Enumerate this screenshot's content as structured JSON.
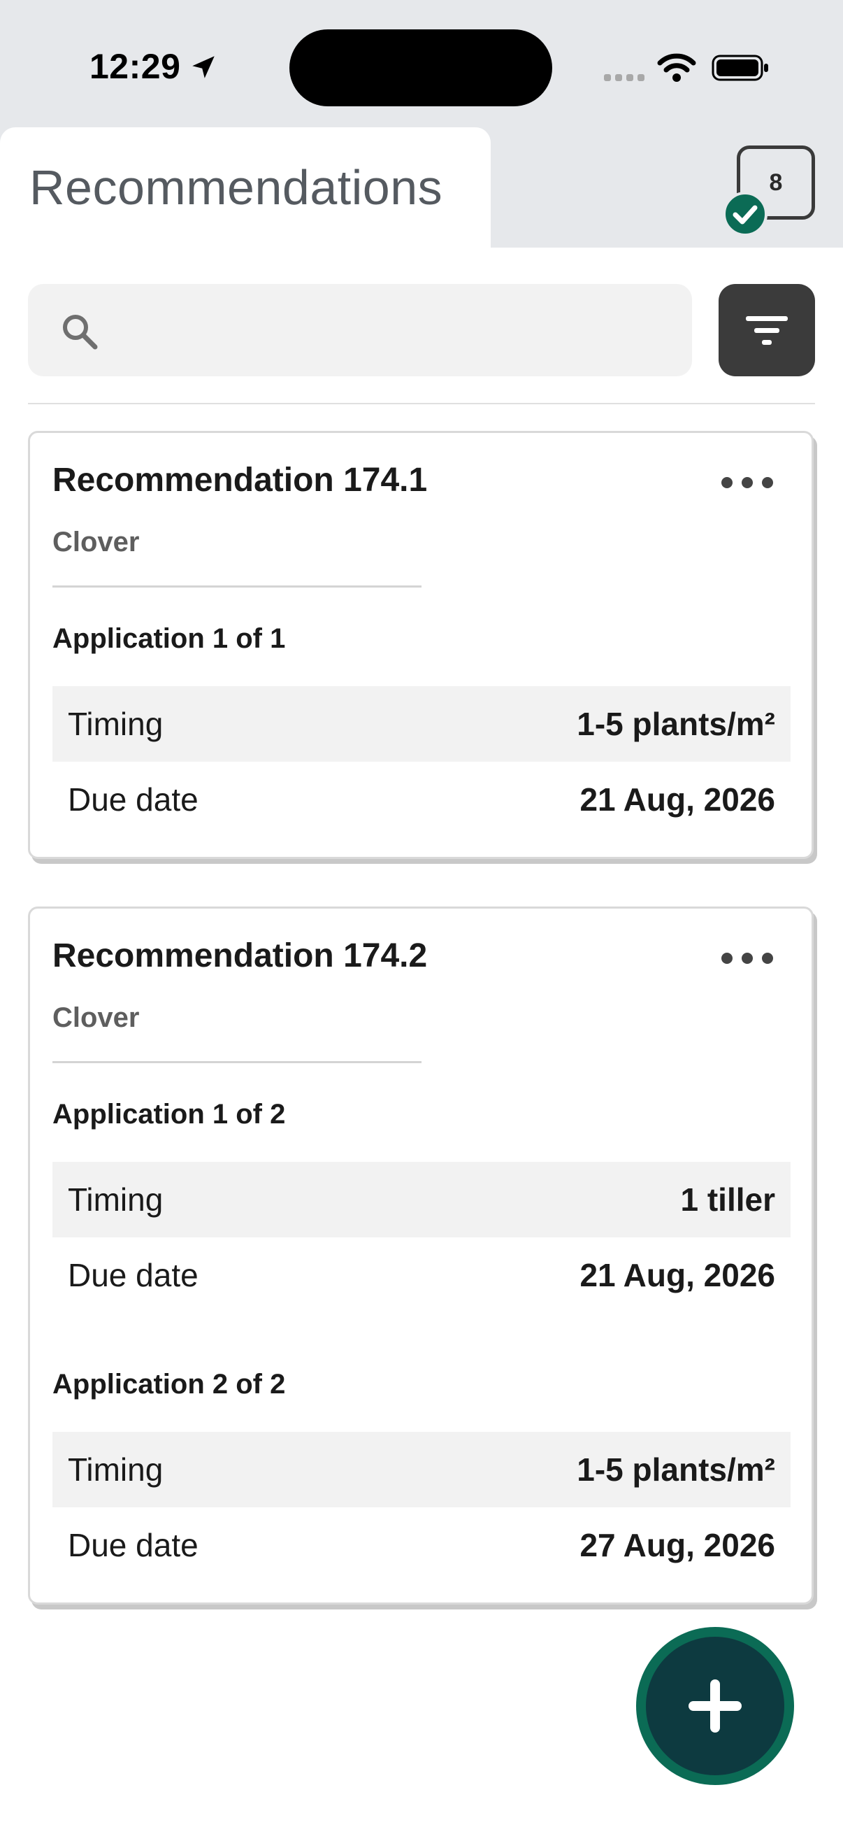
{
  "status_bar": {
    "time": "12:29"
  },
  "header": {
    "title": "Recommendations",
    "badge_count": "8"
  },
  "search": {
    "placeholder": ""
  },
  "colors": {
    "accent_green": "#0b6b55",
    "fab_dark": "#0d3a40",
    "filter_button": "#3b3b3b"
  },
  "icons": {
    "location": "location-arrow-icon",
    "wifi": "wifi-icon",
    "battery": "battery-icon",
    "search": "search-icon",
    "filter": "filter-icon",
    "more": "more-horizontal-icon",
    "check": "check-icon",
    "add": "plus-icon"
  },
  "cards": [
    {
      "title": "Recommendation 174.1",
      "crop": "Clover",
      "applications": [
        {
          "heading": "Application 1 of 1",
          "timing_label": "Timing",
          "timing_value": "1-5 plants/m²",
          "due_label": "Due date",
          "due_value": "21 Aug, 2026"
        }
      ]
    },
    {
      "title": "Recommendation 174.2",
      "crop": "Clover",
      "applications": [
        {
          "heading": "Application 1 of 2",
          "timing_label": "Timing",
          "timing_value": "1 tiller",
          "due_label": "Due date",
          "due_value": "21 Aug, 2026"
        },
        {
          "heading": "Application 2 of 2",
          "timing_label": "Timing",
          "timing_value": "1-5 plants/m²",
          "due_label": "Due date",
          "due_value": "27 Aug, 2026"
        }
      ]
    }
  ]
}
